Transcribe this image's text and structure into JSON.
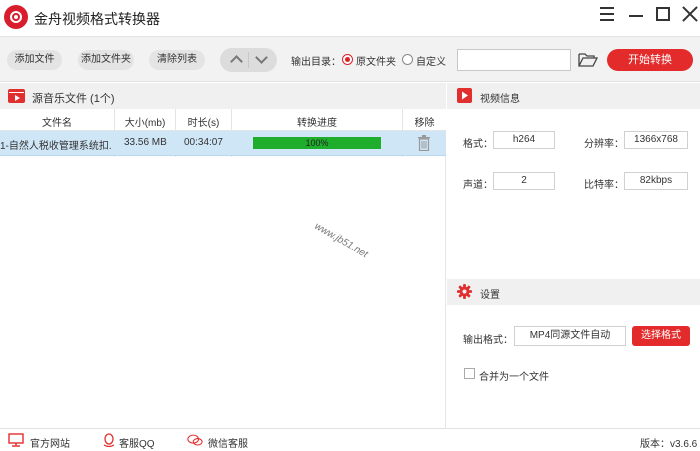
{
  "app": {
    "title": "金舟视频格式转换器"
  },
  "toolbar": {
    "add_file": "添加文件",
    "add_folder": "添加文件夹",
    "clear_list": "清除列表",
    "output_dir_label": "输出目录：",
    "radio_original": "原文件夹",
    "radio_custom": "自定义",
    "selected_output": "原文件夹",
    "path_value": "",
    "start_button": "开始转换"
  },
  "file_list": {
    "title": "源音乐文件 (1个)",
    "columns": [
      "文件名",
      "大小(mb)",
      "时长(s)",
      "转换进度",
      "移除"
    ],
    "rows": [
      {
        "name": "1-自然人税收管理系统扣...",
        "size": "33.56 MB",
        "duration": "00:34:07",
        "progress_text": "100%",
        "progress_value": 100
      }
    ]
  },
  "watermark": "www.jb51.net",
  "video_info": {
    "title": "视频信息",
    "format_label": "格式：",
    "format_value": "h264",
    "resolution_label": "分辨率：",
    "resolution_value": "1366x768",
    "channels_label": "声道：",
    "channels_value": "2",
    "bitrate_label": "比特率：",
    "bitrate_value": "82kbps"
  },
  "settings": {
    "title": "设置",
    "output_format_label": "输出格式：",
    "output_format_value": "MP4同源文件自动",
    "choose_format_button": "选择格式",
    "merge_label": "合并为一个文件",
    "merge_checked": false
  },
  "status_bar": {
    "website": "官方网站",
    "qq": "客服QQ",
    "wechat": "微信客服",
    "version": "版本：v3.6.6"
  },
  "colors": {
    "accent": "#e32b2b",
    "progress": "#1fae2c",
    "selected_row": "#cfe6f7"
  }
}
